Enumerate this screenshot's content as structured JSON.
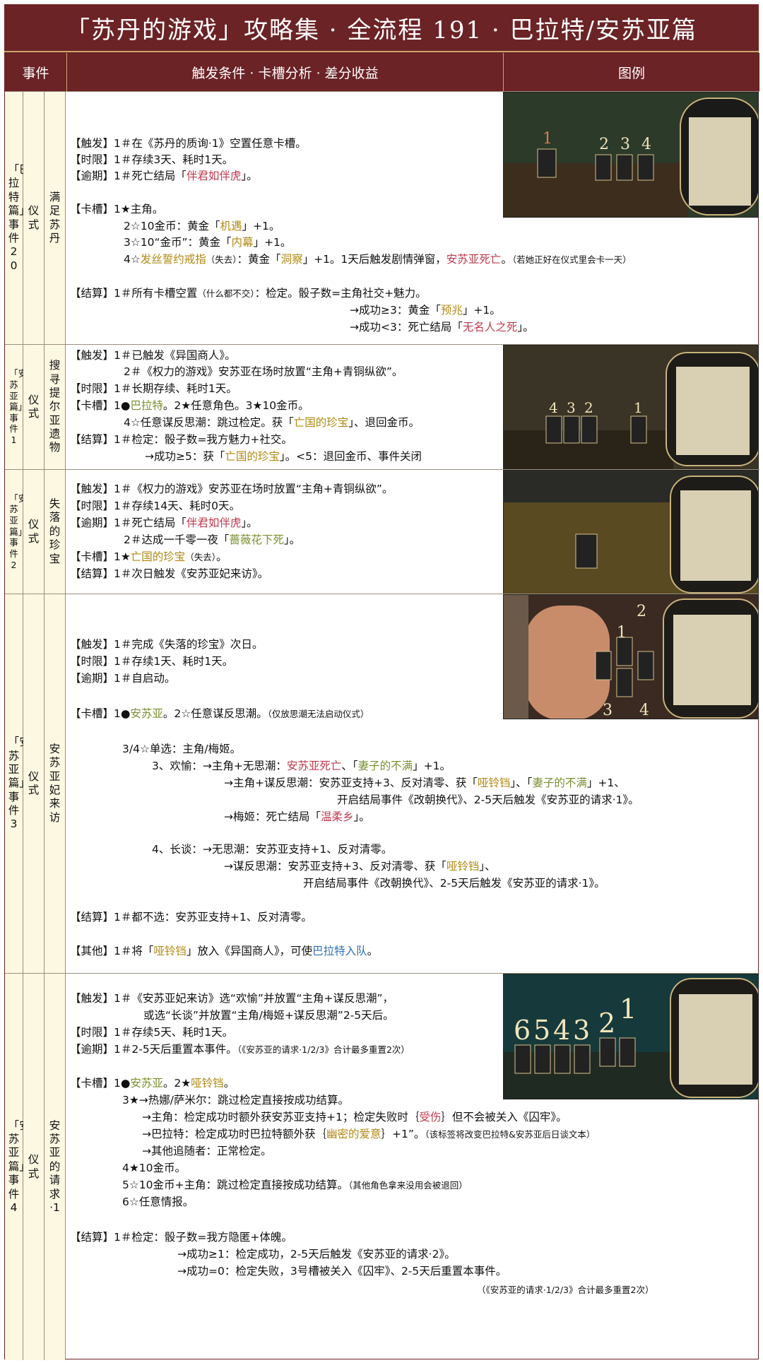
{
  "title": "「苏丹的游戏」攻略集 · 全流程 191 · 巴拉特/安苏亚篇",
  "headers": {
    "event": "事件",
    "detail": "触发条件 · 卡槽分析 · 差分收益",
    "legend": "图例"
  },
  "rows": [
    {
      "c1": "「巴拉特篇」事件20",
      "c2": "仪式",
      "c3": "满足苏丹",
      "lines": [
        [
          "【触发】1＃在《苏丹的质询·1》空置任意卡槽。"
        ],
        [
          "【时限】1＃存续3天、耗时1天。"
        ],
        [
          "【逾期】1＃死亡结局「",
          "伴君如伴虎",
          "」。"
        ],
        [
          "【卡槽】1★主角。"
        ],
        [
          "2☆10金币：黄金「",
          "机遇",
          "」+1。"
        ],
        [
          "3☆10“金币”：黄金「",
          "内幕",
          "」+1。"
        ],
        [
          "4☆",
          "发丝誓约戒指",
          "（失去）",
          "：黄金「",
          "洞察",
          "」+1。1天后触发剧情弹窗，",
          "安苏亚死亡",
          "。",
          "（若她正好在仪式里会卡一天）"
        ],
        [
          "【结算】1＃所有卡槽空置",
          "（什么都不交）",
          "：检定。骰子数=主角社交+魅力。"
        ],
        [
          "→成功≥3：黄金「",
          "预兆",
          "」+1。"
        ],
        [
          "→成功<3：死亡结局「",
          "无名人之死",
          "」。"
        ]
      ]
    },
    {
      "c1": "「安苏亚篇」事件1",
      "c2": "仪式",
      "c3": "搜寻提尔亚遗物",
      "lines": [
        [
          "【触发】1＃已触发《异国商人》。"
        ],
        [
          "2＃《权力的游戏》安苏亚在场时放置“主角+青铜纵欲”。"
        ],
        [
          "【时限】1＃长期存续、耗时1天。"
        ],
        [
          "【卡槽】1●",
          "巴拉特",
          "。2★任意角色。3★10金币。"
        ],
        [
          "4☆任意谋反思潮：跳过检定。获「",
          "亡国的珍宝",
          "」、退回金币。"
        ],
        [
          "【结算】1＃检定：骰子数=我方魅力+社交。"
        ],
        [
          "→成功≥5：获「",
          "亡国的珍宝",
          "」。<5：退回金币、事件关闭"
        ]
      ]
    },
    {
      "c1": "「安苏亚篇」事件2",
      "c2": "仪式",
      "c3": "失落的珍宝",
      "lines": [
        [
          "【触发】1＃《权力的游戏》安苏亚在场时放置“主角+青铜纵欲”。"
        ],
        [
          "【时限】1＃存续14天、耗时0天。"
        ],
        [
          "【逾期】1＃死亡结局「",
          "伴君如伴虎",
          "」。"
        ],
        [
          "2＃达成一千零一夜「",
          "蔷薇花下死",
          "」。"
        ],
        [
          "【卡槽】1★",
          "亡国的珍宝",
          "（失去）",
          "。"
        ],
        [
          "【结算】1＃次日触发《安苏亚妃来访》。"
        ]
      ]
    },
    {
      "c1": "「安苏亚篇」事件3",
      "c2": "仪式",
      "c3": "安苏亚妃来访",
      "lines": [
        [
          "【触发】1＃完成《失落的珍宝》次日。"
        ],
        [
          "【时限】1＃存续1天、耗时1天。"
        ],
        [
          "【逾期】1＃自启动。"
        ],
        [
          "【卡槽】1●",
          "安苏亚",
          "。2☆任意谋反思潮。",
          "（仅放思潮无法启动仪式）"
        ],
        [
          "3/4☆单选：主角/梅姬。"
        ],
        [
          "3、欢愉：→主角+无思潮：",
          "安苏亚死亡",
          "、「",
          "妻子的不满",
          "」+1。"
        ],
        [
          "→主角+谋反思潮：安苏亚支持+3、反对清零、获「",
          "哑铃铛",
          "」、「",
          "妻子的不满",
          "」+1、"
        ],
        [
          "开启结局事件《改朝换代》、2-5天后触发《安苏亚的请求·1》。"
        ],
        [
          "→梅姬：死亡结局「",
          "温柔乡",
          "」。"
        ],
        [
          "4、长谈：→无思潮：安苏亚支持+1、反对清零。"
        ],
        [
          "→谋反思潮：安苏亚支持+3、反对清零、获「",
          "哑铃铛",
          "」、"
        ],
        [
          "开启结局事件《改朝换代》、2-5天后触发《安苏亚的请求·1》。"
        ],
        [
          "【结算】1＃都不选：安苏亚支持+1、反对清零。"
        ],
        [
          "【其他】1＃将「",
          "哑铃铛",
          "」放入《异国商人》，可使",
          "巴拉特入队",
          "。"
        ]
      ]
    },
    {
      "c1": "「安苏亚篇」事件4",
      "c2": "仪式",
      "c3": "安苏亚的请求·1",
      "lines": [
        [
          "【触发】1＃《安苏亚妃来访》选“欢愉”并放置“主角+谋反思潮”，"
        ],
        [
          "或选“长谈”并放置“主角/梅姬+谋反思潮”2-5天后。"
        ],
        [
          "【时限】1＃存续5天、耗时1天。"
        ],
        [
          "【逾期】1＃2-5天后重置本事件。",
          "（《安苏亚的请求·1/2/3》合计最多重置2次）"
        ],
        [
          "【卡槽】1●",
          "安苏亚",
          "。2★",
          "哑铃铛",
          "。"
        ],
        [
          "3★→热娜/萨米尔：跳过检定直接按成功结算。"
        ],
        [
          "→主角：检定成功时额外获安苏亚支持+1；检定失败时｛",
          "受伤",
          "｝但不会被关入《囚牢》。"
        ],
        [
          "→巴拉特：检定成功时巴拉特额外获｛",
          "幽密的爱意",
          "｝+1”。",
          "（该标签将改变巴拉特&安苏亚后日谈文本）"
        ],
        [
          "→其他追随者：正常检定。"
        ],
        [
          "4★10金币。"
        ],
        [
          "5☆10金币+主角：跳过检定直接按成功结算。",
          "（其他角色拿来没用会被退回）"
        ],
        [
          "6☆任意情报。"
        ],
        [
          "【结算】1＃检定：骰子数=我方隐匿+体魄。"
        ],
        [
          "→成功≥1：检定成功，2-5天后触发《安苏亚的请求·2》。"
        ],
        [
          "→成功=0：检定失败，3号槽被关入《囚牢》、2-5天后重置本事件。"
        ],
        [
          "（《安苏亚的请求·1/2/3》合计最多重置2次）"
        ]
      ]
    }
  ],
  "legend_numbers": {
    "r1": [
      "1",
      "2",
      "3",
      "4"
    ],
    "r2": [
      "4",
      "3",
      "2",
      "1"
    ],
    "r4": [
      "1",
      "2",
      "3",
      "4"
    ],
    "r5": [
      "6",
      "5",
      "4",
      "3",
      "2",
      "1"
    ]
  },
  "colors": {
    "title_bg": "#6b2326",
    "cell_bg": "#fdf8e1",
    "gold": "#b08a12",
    "red": "#c0394d",
    "green": "#7a8f2e",
    "blue": "#2a6fb8"
  }
}
